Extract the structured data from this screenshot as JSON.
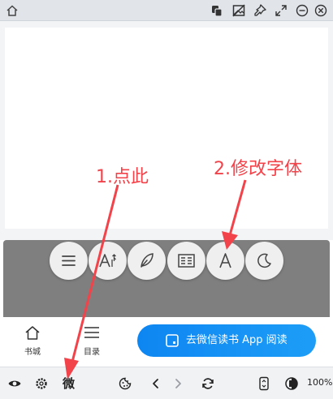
{
  "titlebar": {
    "icons": [
      "home-icon",
      "window-copy-icon",
      "image-off-icon",
      "pin-icon",
      "expand-icon",
      "minimize-icon",
      "close-icon"
    ]
  },
  "toolbar": {
    "buttons": [
      "menu-icon",
      "font-size-icon",
      "feather-icon",
      "layout-icon",
      "font-icon",
      "moon-icon"
    ]
  },
  "nav": {
    "bookshelf_label": "书城",
    "toc_label": "目录"
  },
  "app_button": {
    "label": "去微信读书 App 阅读",
    "color": "#1490f4"
  },
  "browser_bar": {
    "wei_glyph": "微",
    "zoom": "100%"
  },
  "annotations": {
    "step1": "1.点此",
    "step2": "2.修改字体",
    "color": "#f2434a"
  }
}
